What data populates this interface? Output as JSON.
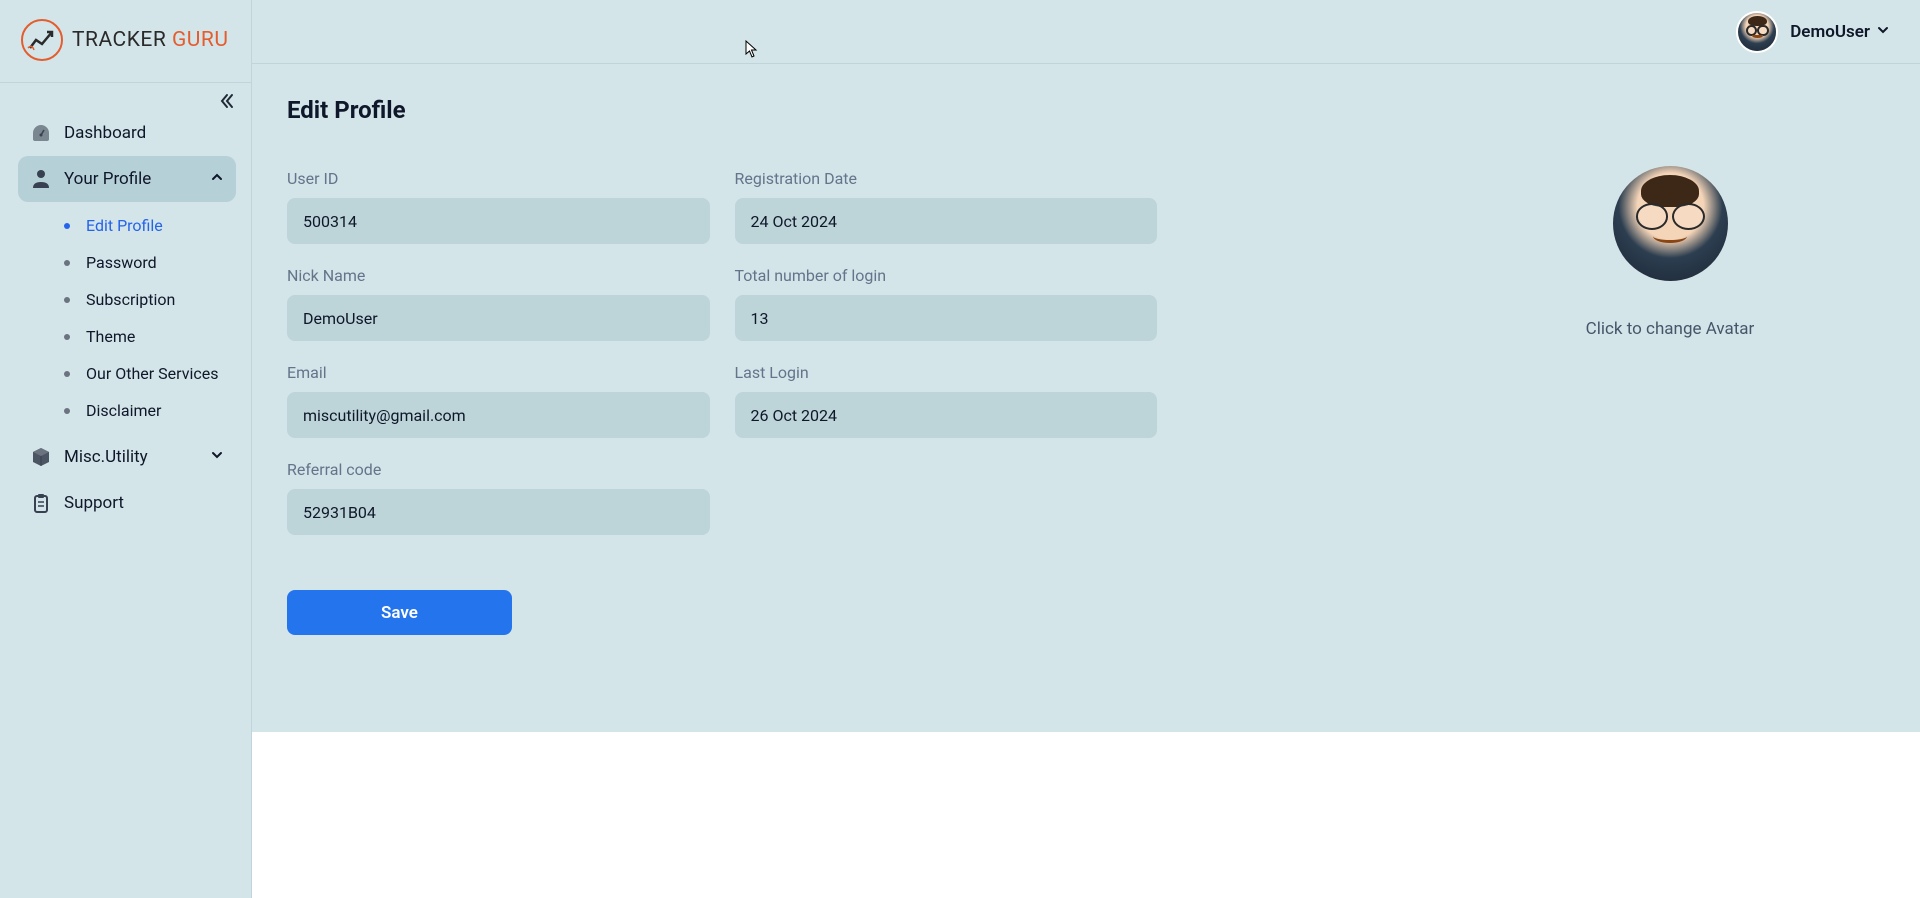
{
  "brand": {
    "name_part1": "TRACKER ",
    "name_part2": "GURU"
  },
  "user": {
    "display_name": "DemoUser"
  },
  "sidebar": {
    "dashboard": "Dashboard",
    "your_profile": "Your Profile",
    "sub_items": {
      "edit_profile": "Edit Profile",
      "password": "Password",
      "subscription": "Subscription",
      "theme": "Theme",
      "other_services": "Our Other Services",
      "disclaimer": "Disclaimer"
    },
    "misc_utility": "Misc.Utility",
    "support": "Support"
  },
  "page": {
    "title": "Edit Profile",
    "labels": {
      "user_id": "User ID",
      "registration_date": "Registration Date",
      "nick_name": "Nick Name",
      "total_logins": "Total number of login",
      "email": "Email",
      "last_login": "Last Login",
      "referral_code": "Referral code"
    },
    "values": {
      "user_id": "500314",
      "registration_date": "24 Oct 2024",
      "nick_name": "DemoUser",
      "total_logins": "13",
      "email": "miscutility@gmail.com",
      "last_login": "26 Oct 2024",
      "referral_code": "52931B04"
    },
    "save_button": "Save",
    "avatar_caption": "Click to change Avatar"
  }
}
